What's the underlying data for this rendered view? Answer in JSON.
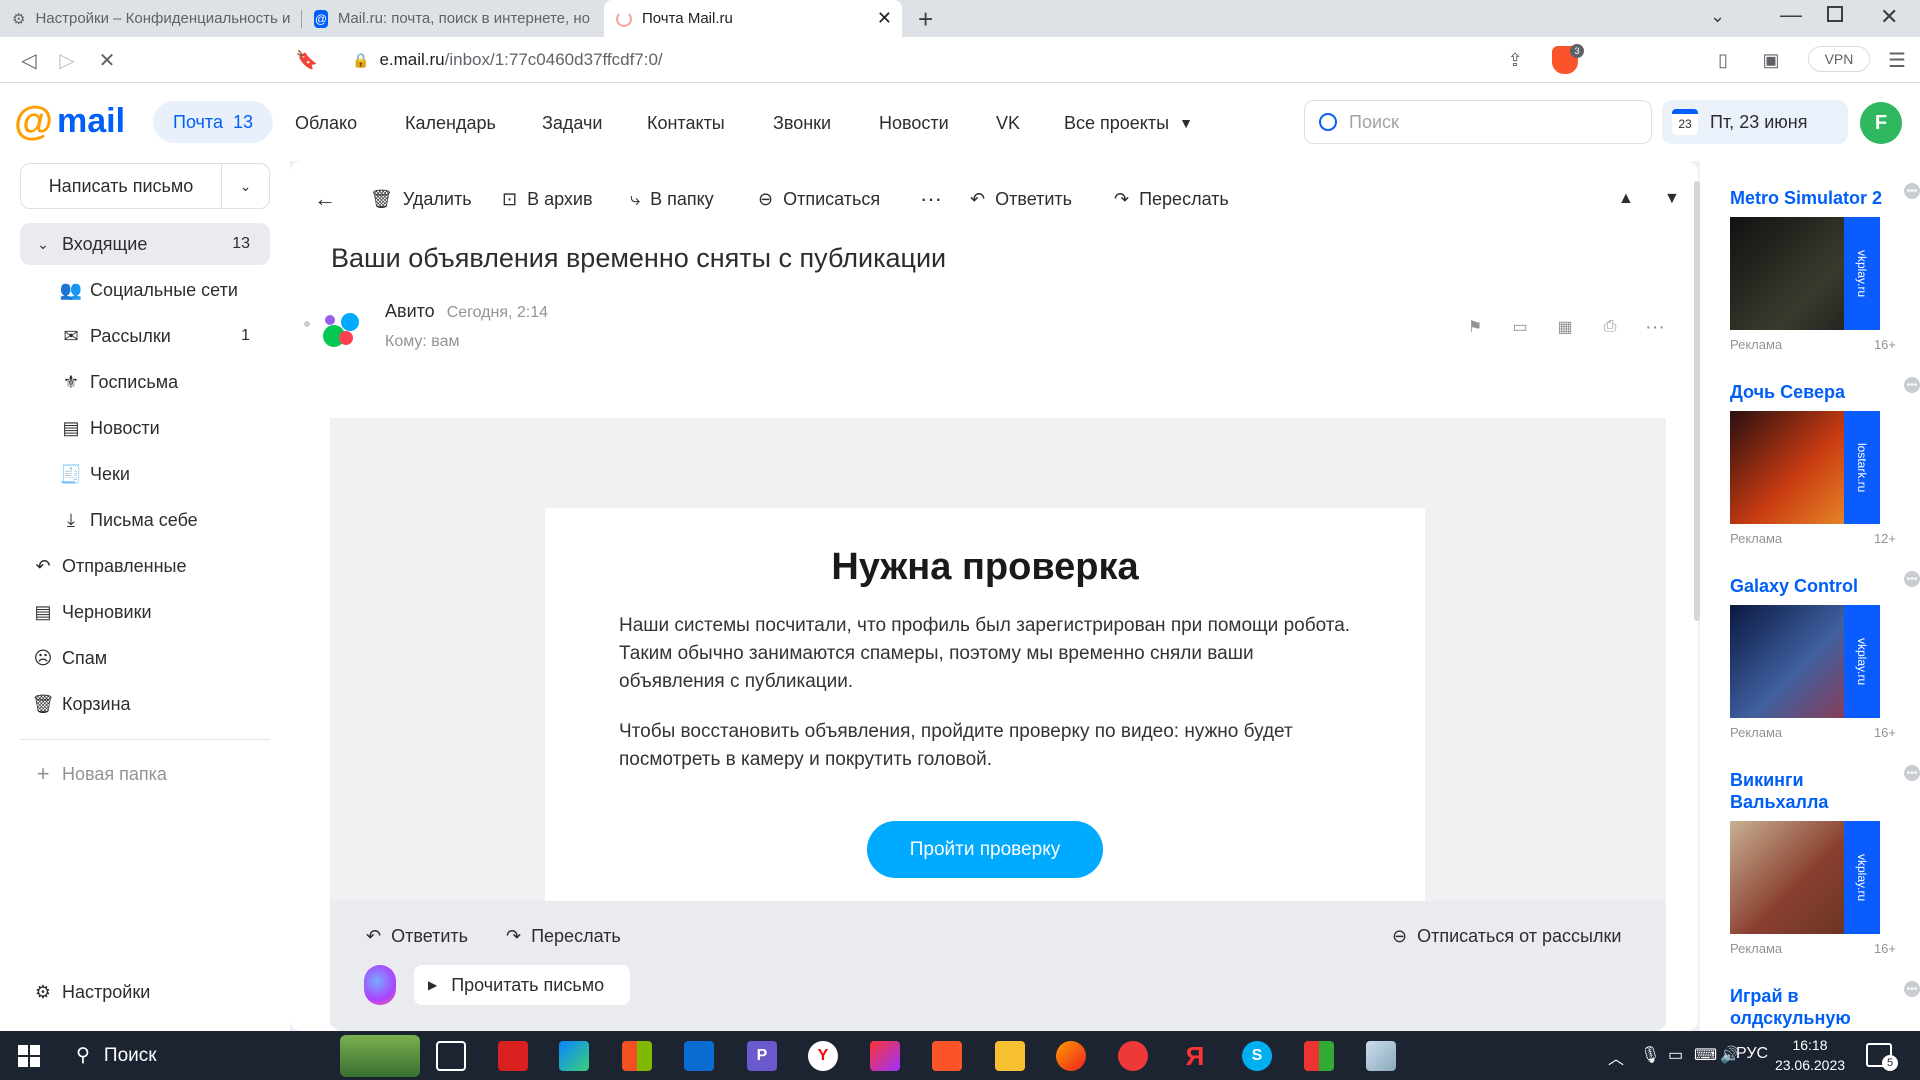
{
  "browser": {
    "tabs": [
      {
        "label": "Настройки – Конфиденциальность и"
      },
      {
        "label": "Mail.ru: почта, поиск в интернете, но"
      },
      {
        "label": "Почта Mail.ru"
      }
    ],
    "url_host": "e.mail.ru",
    "url_path": "/inbox/1:77c0460d37ffcdf7:0/",
    "vpn_label": "VPN",
    "brave_badge": "3"
  },
  "header": {
    "logo": "mail",
    "pochta_label": "Почта",
    "pochta_count": "13",
    "nav": [
      "Облако",
      "Календарь",
      "Задачи",
      "Контакты",
      "Звонки",
      "Новости",
      "VK",
      "Все проекты"
    ],
    "search_placeholder": "Поиск",
    "date_day": "23",
    "date_label": "Пт, 23 июня",
    "avatar_letter": "F"
  },
  "sidebar": {
    "compose_label": "Написать письмо",
    "inbox": {
      "label": "Входящие",
      "count": "13"
    },
    "subfolders": [
      {
        "label": "Социальные сети",
        "count": ""
      },
      {
        "label": "Рассылки",
        "count": "1"
      },
      {
        "label": "Госписьма",
        "count": ""
      },
      {
        "label": "Новости",
        "count": ""
      },
      {
        "label": "Чеки",
        "count": ""
      },
      {
        "label": "Письма себе",
        "count": ""
      }
    ],
    "folders": [
      {
        "label": "Отправленные"
      },
      {
        "label": "Черновики"
      },
      {
        "label": "Спам"
      },
      {
        "label": "Корзина"
      }
    ],
    "new_folder": "Новая папка",
    "settings": "Настройки"
  },
  "toolbar": {
    "delete": "Удалить",
    "archive": "В архив",
    "to_folder": "В папку",
    "unsubscribe": "Отписаться",
    "reply": "Ответить",
    "forward": "Переслать"
  },
  "message": {
    "subject": "Ваши объявления временно сняты с публикации",
    "sender": "Авито",
    "time": "Сегодня, 2:14",
    "to": "Кому: вам",
    "body_heading": "Нужна проверка",
    "body_p1": "Наши системы посчитали, что профиль был зарегистрирован при помощи робота. Таким обычно занимаются спамеры, поэтому мы временно сняли ваши объявления с публикации.",
    "body_p2": "Чтобы восстановить объявления, пройдите проверку по видео: нужно будет посмотреть в камеру и покрутить головой.",
    "cta": "Пройти проверку"
  },
  "bottombar": {
    "reply": "Ответить",
    "forward": "Переслать",
    "unsubscribe": "Отписаться от рассылки",
    "read_aloud": "Прочитать письмо"
  },
  "ads": [
    {
      "title": "Metro Simulator 2",
      "site": "vkplay.ru",
      "label": "Реклама",
      "age": "16+"
    },
    {
      "title": "Дочь Севера",
      "site": "lostark.ru",
      "label": "Реклама",
      "age": "12+"
    },
    {
      "title": "Galaxy Control",
      "site": "vkplay.ru",
      "label": "Реклама",
      "age": "16+"
    },
    {
      "title": "Викинги Вальхалла",
      "site": "vkplay.ru",
      "label": "Реклама",
      "age": "16+"
    },
    {
      "title": "Играй в олдскульную",
      "site": "",
      "label": "",
      "age": ""
    }
  ],
  "taskbar": {
    "search": "Поиск",
    "lang": "РУС",
    "time": "16:18",
    "date": "23.06.2023",
    "notif_count": "5"
  },
  "colors": {
    "accent": "#005ff9",
    "cta": "#00aaff",
    "taskbar": "#1c2331"
  }
}
